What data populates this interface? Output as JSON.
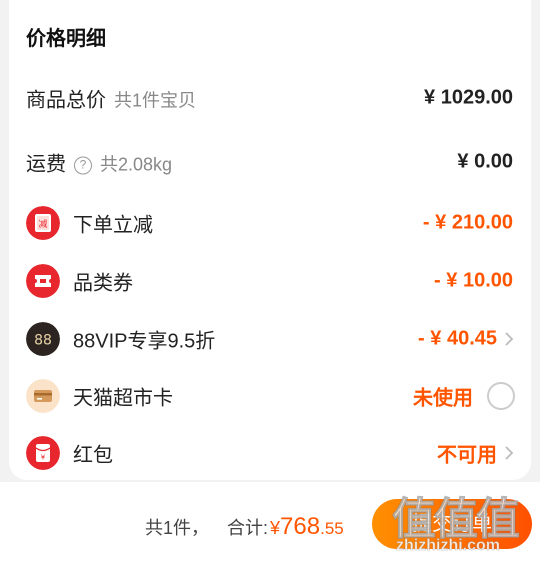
{
  "panel": {
    "title": "价格明细",
    "goods_total": {
      "label": "商品总价",
      "note": "共1件宝贝",
      "value": "¥ 1029.00"
    },
    "shipping": {
      "label": "运费",
      "help_icon": "question-icon",
      "note": "共2.08kg",
      "value": "¥ 0.00"
    },
    "discounts": [
      {
        "label": "下单立减",
        "icon": "reduce-icon",
        "value": "- ¥ 210.00"
      },
      {
        "label": "品类券",
        "icon": "ticket-icon",
        "value": "- ¥ 10.00"
      },
      {
        "label": "88VIP专享9.5折",
        "icon": "vip88-icon",
        "value": "- ¥ 40.45"
      },
      {
        "label": "天猫超市卡",
        "icon": "card-icon",
        "value": "未使用"
      },
      {
        "label": "红包",
        "icon": "redpacket-icon",
        "value": "不可用"
      }
    ]
  },
  "footer": {
    "count": "共1件，",
    "total_label": "合计:",
    "currency": "¥",
    "total_int": "768",
    "total_dec": ".55",
    "submit_label": "提交订单"
  },
  "watermark": {
    "text": "值值值",
    "domain": "zhizhizhi.com"
  },
  "colors": {
    "accent": "#ff5500",
    "red_icon": "#e8262d",
    "vip_icon": "#2b2420"
  }
}
